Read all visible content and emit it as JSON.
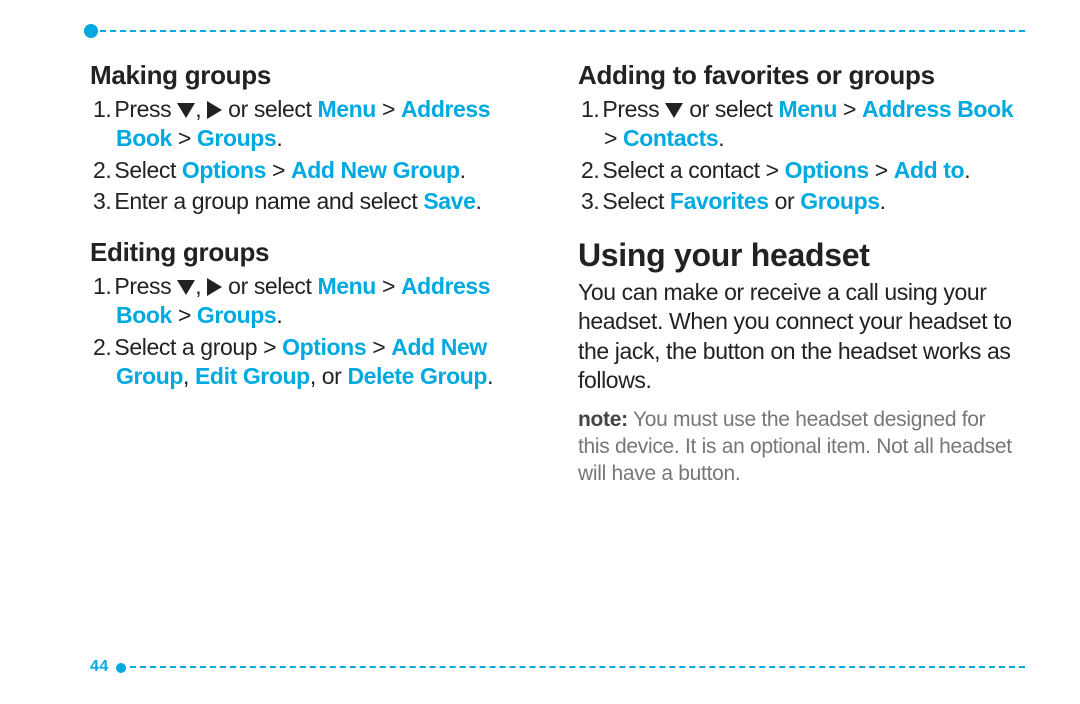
{
  "page_number": "44",
  "left": {
    "section1": {
      "heading": "Making groups",
      "step1_a": "Press ",
      "step1_b": ", ",
      "step1_c": " or select ",
      "step1_menu": "Menu",
      "step1_sep1": " > ",
      "step1_ab": "Address Book",
      "step1_sep2": " > ",
      "step1_groups": "Groups",
      "step1_end": ".",
      "step2_a": "Select ",
      "step2_opt": "Options",
      "step2_sep": " > ",
      "step2_add": "Add New Group",
      "step2_end": ".",
      "step3_a": "Enter a group name and select ",
      "step3_save": "Save",
      "step3_end": "."
    },
    "section2": {
      "heading": "Editing groups",
      "step1_a": "Press ",
      "step1_b": ", ",
      "step1_c": " or select ",
      "step1_menu": "Menu",
      "step1_sep1": " > ",
      "step1_ab": "Address Book",
      "step1_sep2": " > ",
      "step1_groups": "Groups",
      "step1_end": ".",
      "step2_a": "Select a group > ",
      "step2_opt": "Options",
      "step2_sep": " > ",
      "step2_add": "Add New Group",
      "step2_c": ", ",
      "step2_edit": "Edit Group",
      "step2_d": ", or ",
      "step2_del": "Delete Group",
      "step2_end": "."
    }
  },
  "right": {
    "section1": {
      "heading": "Adding to favorites or groups",
      "step1_a": "Press ",
      "step1_b": " or select ",
      "step1_menu": "Menu",
      "step1_sep1": " > ",
      "step1_ab": "Address Book",
      "step1_sep2": " > ",
      "step1_contacts": "Contacts",
      "step1_end": ".",
      "step2_a": "Select a contact > ",
      "step2_opt": "Options",
      "step2_sep": " > ",
      "step2_addto": "Add to",
      "step2_end": ".",
      "step3_a": "Select ",
      "step3_fav": "Favorites",
      "step3_or": " or ",
      "step3_grp": "Groups",
      "step3_end": "."
    },
    "section2": {
      "heading": "Using your headset",
      "body": "You can make or receive a call using your headset. When you connect your headset to the jack, the button on the headset works as follows.",
      "note_label": "note:",
      "note_body": " You must use the headset designed for this device. It is an optional item. Not all headset will have a button."
    }
  }
}
